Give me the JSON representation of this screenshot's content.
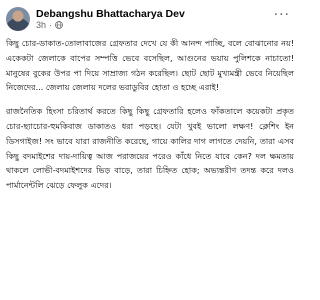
{
  "post": {
    "author": "Debangshu Bhattacharya Dev",
    "time": "3h",
    "separator": "·",
    "privacy_icon": "globe-icon",
    "more_label": "···",
    "paragraphs": [
      "কিছু চোর-ডাকাত-তোলাবাজের গ্রেফতার দেখে যে কী আনন্দ পাচ্ছি, বলে বোঝানোর নয়! একেকটা জেলাকে বাপের সম্পত্তি ভেবে বসেছিল, আগুনের ভয়ায় পুলিশকে নাচাতো! মানুষের বুকের উপর পা দিয়ে সাম্রাজ্য গঠন করেছিল। ছোট ছোট মুখ্যমন্ত্রী ভেবে নিয়েছিল নিজেদের... জেলায় জেলায় দলের ভরাডুবির হোতা ও হচ্ছে এরাই!",
      "রাজনৈতিক হিংসা চরিতার্থ করতে কিছু কিছু গ্রেফতারি হলেও ফাঁকতালে কয়েকটা প্রকৃত চোর-ছ্যাচোর-হুমকিবাজ ডাকাতও ধরা পড়ছে। যেটা খুবই ভালো লক্ষণ! ক্লেশিং ইন ডিসগাইজ! সং ভাবে যারা রাজনীতি করেছে, গায়ে কালির দাগ লাগতে দেয়নি, তারা এসব কিছু বদমাইশের দায়-দায়িত্ব আজ পরাজয়ের পরেও কাঁধে নিতে যাবে কেন? দল ক্ষমতায় থাকলে লোভী-বদমাইশদের ভিড় বাড়ে, তারা চিহ্নিত হোক; অভ্যন্তরীণ তদন্ত করে দলও পার্মানেন্টলি ঝেড়ে ফেলুক এদের।"
    ]
  }
}
